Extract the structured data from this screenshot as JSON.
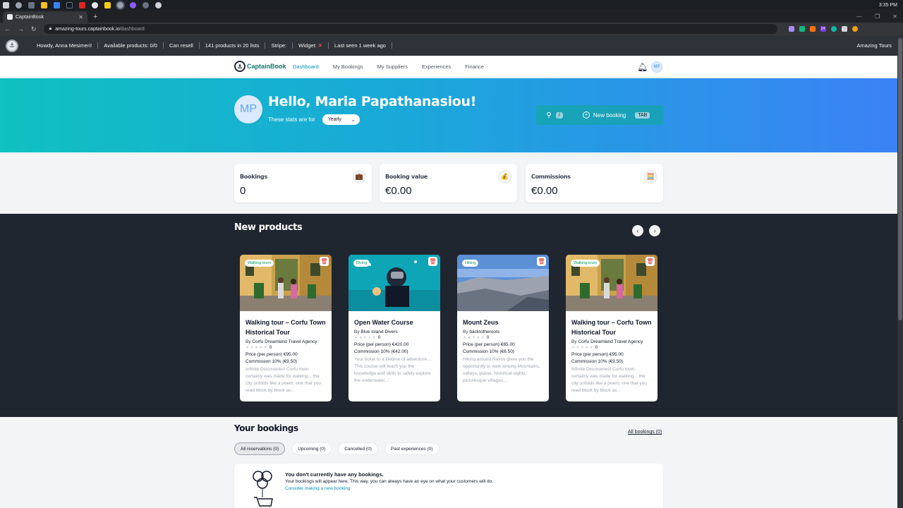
{
  "os": {
    "time": "3:35 PM"
  },
  "browser": {
    "tab_title": "CaptainBook",
    "url_host": "amazing-tours.captainbook.io",
    "url_path": "/dashboard",
    "extension_badge": "24"
  },
  "adminbar": {
    "greeting": "Howdy, Anna Mesimeri!",
    "available_products": "Available products: 0/0",
    "can_resell": "Can resell",
    "products_lists": "141 products in 20 lists",
    "stripe": "Stripe:",
    "widget": "Widget:",
    "widget_status": "✕",
    "last_seen": "Last seen 1 week ago",
    "site_name": "Amazing Tours"
  },
  "nav": {
    "brand": "CaptainBook",
    "links": [
      "Dashboard",
      "My Bookings",
      "My Suppliers",
      "Experiences",
      "Finance"
    ],
    "avatar_initials": "MP"
  },
  "hero": {
    "avatar_initials": "MP",
    "title": "Hello, Maria Papathanasiou!",
    "stats_for": "These stats are for",
    "period": "Yearly",
    "search_shortcut": "/",
    "new_booking": "New booking",
    "new_booking_shortcut": "TAB"
  },
  "stats": [
    {
      "label": "Bookings",
      "value": "0",
      "icon": "briefcase-icon"
    },
    {
      "label": "Booking value",
      "value": "€0.00",
      "icon": "money-bag-icon"
    },
    {
      "label": "Commissions",
      "value": "€0.00",
      "icon": "calculator-icon"
    }
  ],
  "products": {
    "title": "New products",
    "items": [
      {
        "category": "Walking tours",
        "title": "Walking tour – Corfu Town Historical Tour",
        "by_prefix": "By",
        "supplier": "Corfu Dreamland Travel Agency",
        "rating": "0",
        "price": "Price (per person) €95.00",
        "commission": "Commission 10% (€9.50)",
        "description": "Infinite Discoveries! Corfu town certainly was made for walking... the city unfolds like a poem, one that you read block by block as..."
      },
      {
        "category": "Diving",
        "title": "Open Water Course",
        "by_prefix": "By",
        "supplier": "Blue Island Divers",
        "rating": "0",
        "price": "Price (per person) €420.00",
        "commission": "Commission 10% (€42.00)",
        "description": "Your ticket to a lifetime of adventure.... This course will teach you the knowledge and skills to safely explore the underwater..."
      },
      {
        "category": "Hiking",
        "title": "Mount Zeus",
        "by_prefix": "By",
        "supplier": "backtotheroots",
        "rating": "0",
        "price": "Price (per person) €65.00",
        "commission": "Commission 10% (€6.50)",
        "description": "Hiking around Naxos gives you the opportunity to walk among Mountains, valleys, plains, historical sights, picturesque villages,..."
      },
      {
        "category": "Walking tours",
        "title": "Walking tour – Corfu Town Historical Tour",
        "by_prefix": "By",
        "supplier": "Corfu Dreamland Travel Agency",
        "rating": "0",
        "price": "Price (per person) €95.00",
        "commission": "Commission 10% (€9.50)",
        "description": "Infinite Discoveries! Corfu town certainly was made for walking... the city unfolds like a poem, one that you read block by block as..."
      }
    ]
  },
  "bookings": {
    "title": "Your bookings",
    "all_link": "All bookings (0)",
    "tabs": [
      "All reservations (0)",
      "Upcoming (0)",
      "Cancelled (0)",
      "Past experiences (0)"
    ],
    "empty_title": "You don't currently have any bookings.",
    "empty_text": "Your bookings will appear here. This way, you can always have an eye on what your customers will do.",
    "empty_link": "Consider making a new booking"
  },
  "colors": {
    "accent": "#0891b2",
    "hero_start": "#0fc1c0",
    "hero_end": "#3b82f6",
    "dark_section": "#202630",
    "category_badge": "#059669",
    "delete": "#dc2626"
  }
}
